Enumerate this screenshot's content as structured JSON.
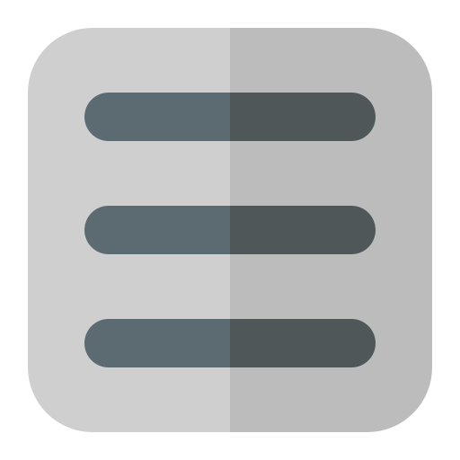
{
  "icon": {
    "name": "hamburger-menu-icon",
    "line_count": 3,
    "colors": {
      "background": "#ffffff",
      "tile_light": "#cfcfcf",
      "tile_dark": "#bcbcbc",
      "bar_light": "#5c6b72",
      "bar_dark": "#4f5759"
    }
  }
}
